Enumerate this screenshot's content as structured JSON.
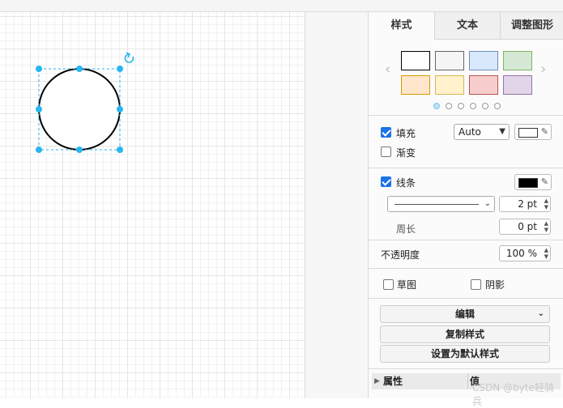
{
  "tabs": [
    "样式",
    "文本",
    "调整图形"
  ],
  "swatches": [
    {
      "fill": "#ffffff",
      "stroke": "#000000"
    },
    {
      "fill": "#f5f5f5",
      "stroke": "#666666"
    },
    {
      "fill": "#dae8fc",
      "stroke": "#6c8ebf"
    },
    {
      "fill": "#d5e8d4",
      "stroke": "#82b366"
    },
    {
      "fill": "#ffe6cc",
      "stroke": "#d79b00"
    },
    {
      "fill": "#fff2cc",
      "stroke": "#d6b656"
    },
    {
      "fill": "#f8cecc",
      "stroke": "#b85450"
    },
    {
      "fill": "#e1d5e7",
      "stroke": "#9673a6"
    }
  ],
  "fill": {
    "label": "填充",
    "checked": true,
    "mode": "Auto",
    "color": "#ffffff"
  },
  "gradient": {
    "label": "渐变",
    "checked": false
  },
  "line": {
    "label": "线条",
    "checked": true,
    "color": "#000000",
    "width": "2 pt"
  },
  "perimeter": {
    "label": "周长",
    "value": "0 pt"
  },
  "opacity": {
    "label": "不透明度",
    "value": "100 %"
  },
  "sketch": {
    "label": "草图",
    "checked": false
  },
  "shadow": {
    "label": "阴影",
    "checked": false
  },
  "buttons": {
    "edit": "编辑",
    "copy_style": "复制样式",
    "set_default": "设置为默认样式"
  },
  "properties": {
    "col1": "属性",
    "col2": "值"
  },
  "watermark": "CSDN @byte轻骑兵",
  "accent_color": "#29b6f2"
}
